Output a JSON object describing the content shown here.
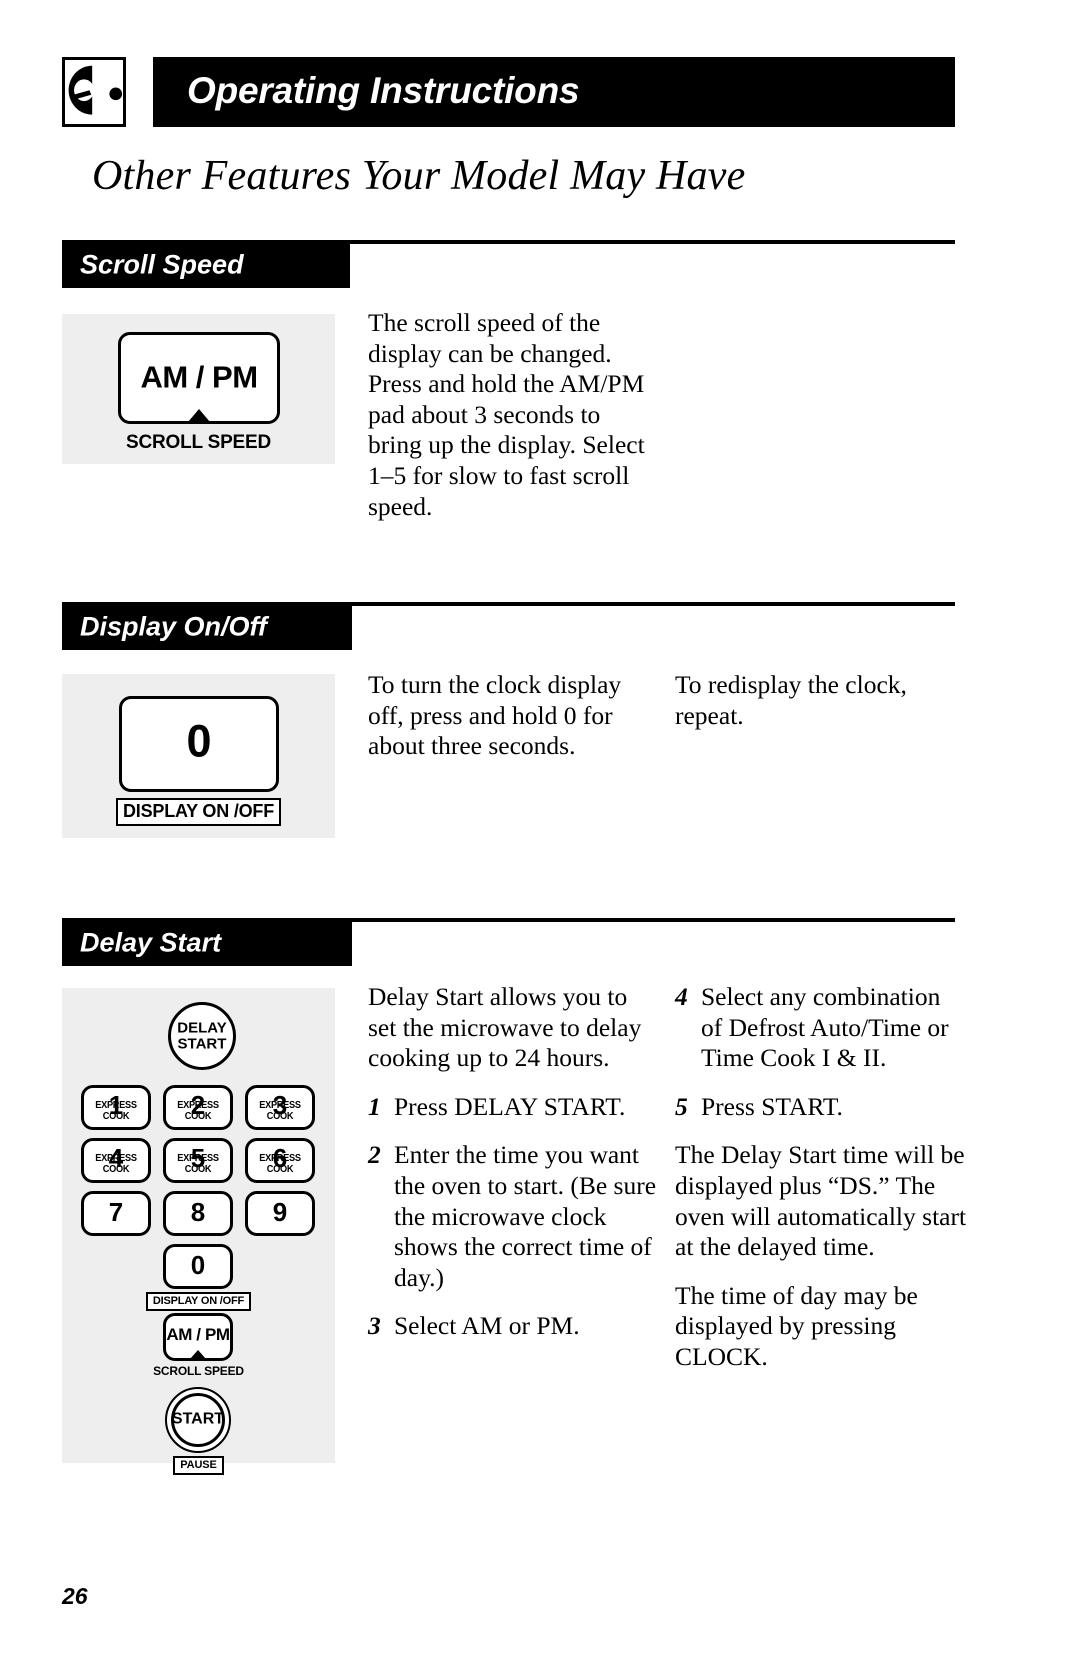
{
  "header": {
    "title": "Operating Instructions",
    "brand_icon": "dial-knob-icon"
  },
  "page_subtitle": "Other Features Your Model May Have",
  "folio": "26",
  "sections": [
    {
      "id": "scroll-speed",
      "tab_label": "Scroll Speed",
      "artwork": {
        "pad_label": "AM / PM",
        "caption": "SCROLL SPEED"
      },
      "columns": [
        {
          "paragraphs": [
            "The scroll speed of the display can be changed. Press and hold the AM/PM pad about 3 seconds to bring up the display. Select 1–5 for slow to fast scroll speed."
          ]
        }
      ]
    },
    {
      "id": "display-on-off",
      "tab_label": "Display On/Off",
      "artwork": {
        "pad_label": "0",
        "caption": "DISPLAY ON /OFF"
      },
      "columns": [
        {
          "paragraphs": [
            "To turn the clock display off, press and hold 0 for about three seconds."
          ]
        },
        {
          "paragraphs": [
            "To redisplay the clock, repeat."
          ]
        }
      ]
    },
    {
      "id": "delay-start",
      "tab_label": "Delay Start",
      "artwork": {
        "delay_start_label_line1": "DELAY",
        "delay_start_label_line2": "START",
        "keys": [
          {
            "digit": "1",
            "sub": "EXPRESS COOK"
          },
          {
            "digit": "2",
            "sub": "EXPRESS COOK"
          },
          {
            "digit": "3",
            "sub": "EXPRESS COOK"
          },
          {
            "digit": "4",
            "sub": "EXPRESS COOK"
          },
          {
            "digit": "5",
            "sub": "EXPRESS COOK"
          },
          {
            "digit": "6",
            "sub": "EXPRESS COOK"
          },
          {
            "digit": "7",
            "sub": ""
          },
          {
            "digit": "8",
            "sub": ""
          },
          {
            "digit": "9",
            "sub": ""
          }
        ],
        "zero_key": {
          "digit": "0",
          "caption": "DISPLAY ON /OFF"
        },
        "ampm_key": {
          "label": "AM / PM",
          "caption": "SCROLL SPEED"
        },
        "start_key": {
          "label": "START",
          "caption": "PAUSE"
        }
      },
      "columns": [
        {
          "intro": "Delay Start allows you to set the microwave to delay cooking up to 24 hours.",
          "steps": [
            {
              "num": "1",
              "text": "Press DELAY START."
            },
            {
              "num": "2",
              "text": "Enter the time you want the oven to start. (Be sure the microwave clock shows the correct time of day.)"
            },
            {
              "num": "3",
              "text": "Select AM or PM."
            }
          ]
        },
        {
          "steps": [
            {
              "num": "4",
              "text": "Select any combination of Defrost Auto/Time or Time Cook I & II."
            },
            {
              "num": "5",
              "text": "Press START."
            }
          ],
          "paragraphs": [
            "The Delay Start time will be displayed plus “DS.” The oven will automatically start at the delayed time.",
            "The time of day may be displayed by pressing CLOCK."
          ]
        }
      ]
    }
  ],
  "colors": {
    "ink": "#000000",
    "paper": "#ffffff",
    "panel": "#eeeeee"
  }
}
